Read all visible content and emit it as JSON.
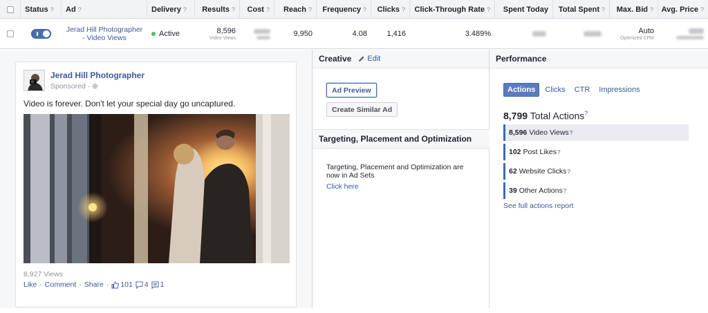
{
  "header": {
    "columns": [
      {
        "label": "",
        "help": ""
      },
      {
        "label": "Status",
        "help": "?"
      },
      {
        "label": "Ad",
        "help": "?"
      },
      {
        "label": "Delivery",
        "help": "?"
      },
      {
        "label": "Results",
        "help": "?"
      },
      {
        "label": "Cost",
        "help": "?"
      },
      {
        "label": "Reach",
        "help": "?"
      },
      {
        "label": "Frequency",
        "help": "?"
      },
      {
        "label": "Clicks",
        "help": "?"
      },
      {
        "label": "Click-Through Rate",
        "help": "?"
      },
      {
        "label": "Spent Today",
        "help": ""
      },
      {
        "label": "Total Spent",
        "help": "?"
      },
      {
        "label": "Max. Bid",
        "help": "?"
      },
      {
        "label": "Avg. Price",
        "help": "?"
      }
    ]
  },
  "row": {
    "ad_name": "Jerad Hill Photographer - Video Views",
    "delivery": "Active",
    "results": "8,596",
    "results_sub": "Video Views",
    "reach": "9,950",
    "frequency": "4.08",
    "clicks": "1,416",
    "ctr": "3.489%",
    "max_bid": "Auto",
    "max_bid_sub": "Optimized CPM"
  },
  "preview": {
    "page_name": "Jerad Hill Photographer",
    "sponsored": "Sponsored",
    "post_text": "Video is forever. Don't let your special day go uncaptured.",
    "views": "8,927 Views",
    "like": "Like",
    "comment": "Comment",
    "share": "Share",
    "likes_count": "101",
    "comments_count": "4",
    "shares_count": "1"
  },
  "creative": {
    "title": "Creative",
    "edit": "Edit",
    "ad_preview_button": "Ad Preview",
    "create_similar_button": "Create Similar Ad",
    "tpo_title": "Targeting, Placement and Optimization",
    "tpo_text": "Targeting, Placement and Optimization are now in Ad Sets",
    "tpo_link": "Click here"
  },
  "performance": {
    "title": "Performance",
    "tabs": [
      "Actions",
      "Clicks",
      "CTR",
      "Impressions"
    ],
    "total_value": "8,799",
    "total_label": "Total Actions",
    "items": [
      {
        "value": "8,596",
        "label": "Video Views"
      },
      {
        "value": "102",
        "label": "Post Likes"
      },
      {
        "value": "62",
        "label": "Website Clicks"
      },
      {
        "value": "39",
        "label": "Other Actions"
      }
    ],
    "full_report": "See full actions report"
  },
  "colors": {
    "link": "#3b5998",
    "active_dot": "#5cb85c",
    "tab_active": "#5b7bbd"
  }
}
